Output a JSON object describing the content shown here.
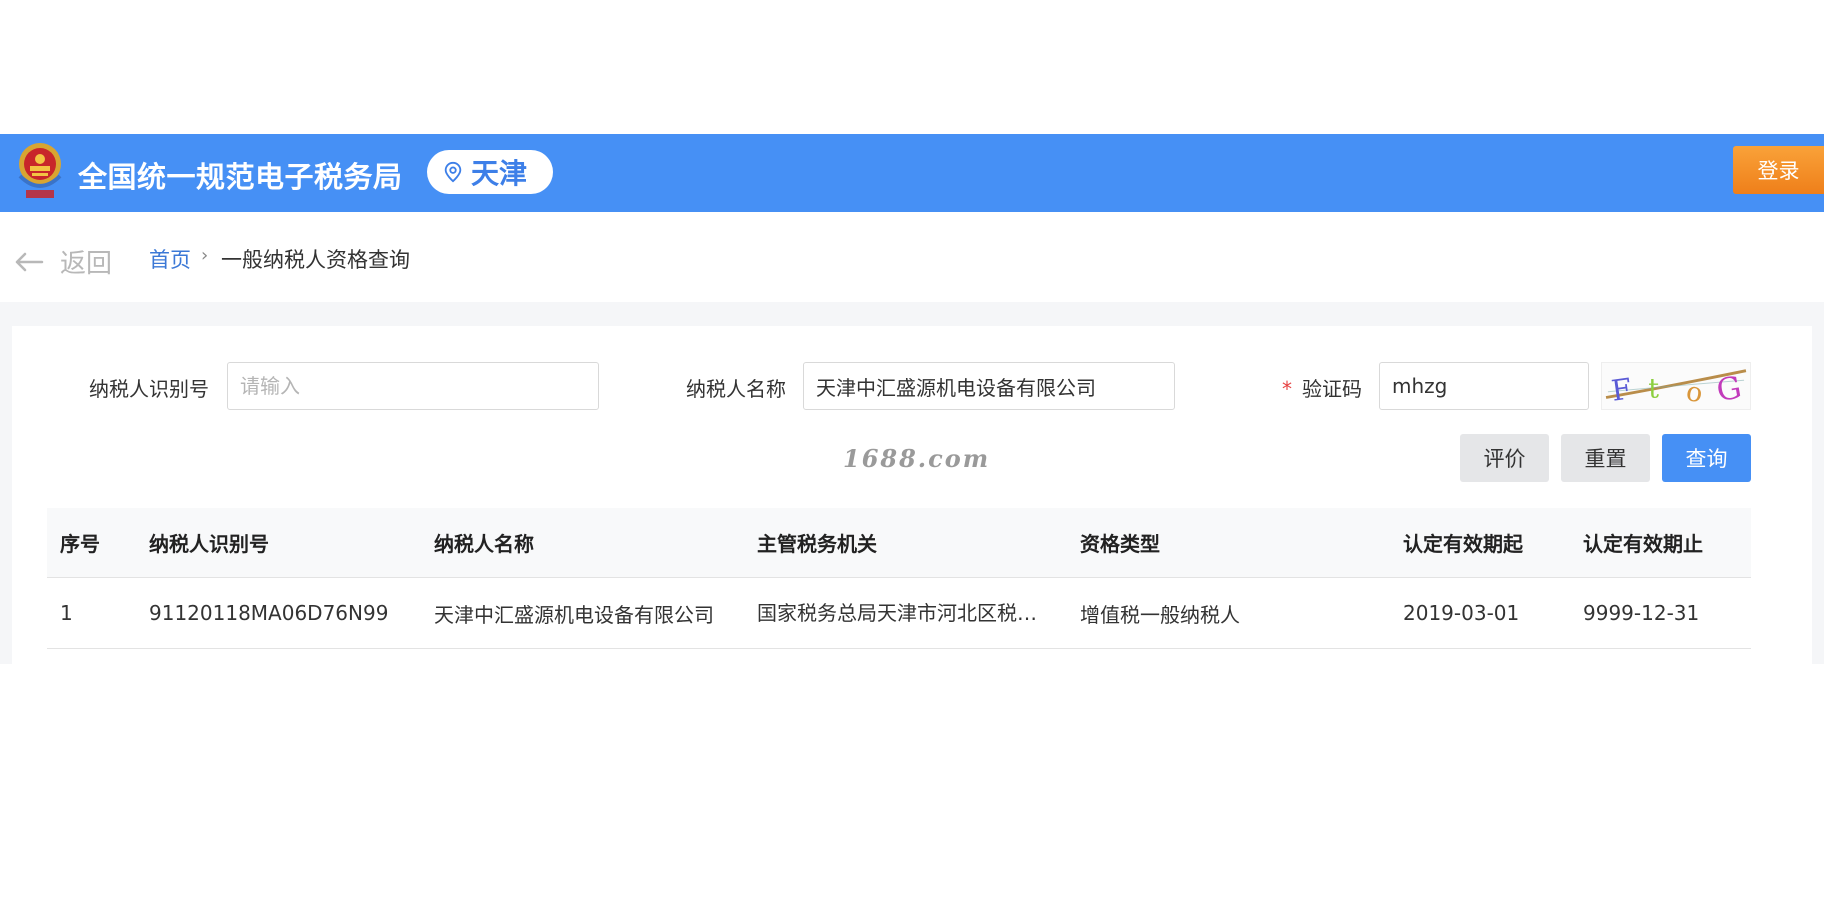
{
  "header": {
    "site_title": "全国统一规范电子税务局",
    "region": "天津",
    "login_label": "登录",
    "emblem_icon": "tax-emblem-icon",
    "location_icon": "map-pin-icon"
  },
  "breadcrumb": {
    "back_label": "返回",
    "home_label": "首页",
    "separator": "›",
    "current_label": "一般纳税人资格查询"
  },
  "form": {
    "taxpayer_id": {
      "label": "纳税人识别号",
      "value": "",
      "placeholder": "请输入"
    },
    "taxpayer_name": {
      "label": "纳税人名称",
      "value": "天津中汇盛源机电设备有限公司"
    },
    "captcha": {
      "required_mark": "*",
      "label": "验证码",
      "value": "mhzg",
      "image_text": "F t o G"
    }
  },
  "watermark": "1688.com",
  "actions": {
    "rate_label": "评价",
    "reset_label": "重置",
    "search_label": "查询"
  },
  "table": {
    "headers": [
      "序号",
      "纳税人识别号",
      "纳税人名称",
      "主管税务机关",
      "资格类型",
      "认定有效期起",
      "认定有效期止"
    ],
    "rows": [
      [
        "1",
        "91120118MA06D76N99",
        "天津中汇盛源机电设备有限公司",
        "国家税务总局天津市河北区税…",
        "增值税一般纳税人",
        "2019-03-01",
        "9999-12-31"
      ]
    ]
  },
  "colors": {
    "header_blue": "#4690f5",
    "login_orange": "#f08a24",
    "link_blue": "#3b78d6",
    "required_red": "#e64242"
  }
}
